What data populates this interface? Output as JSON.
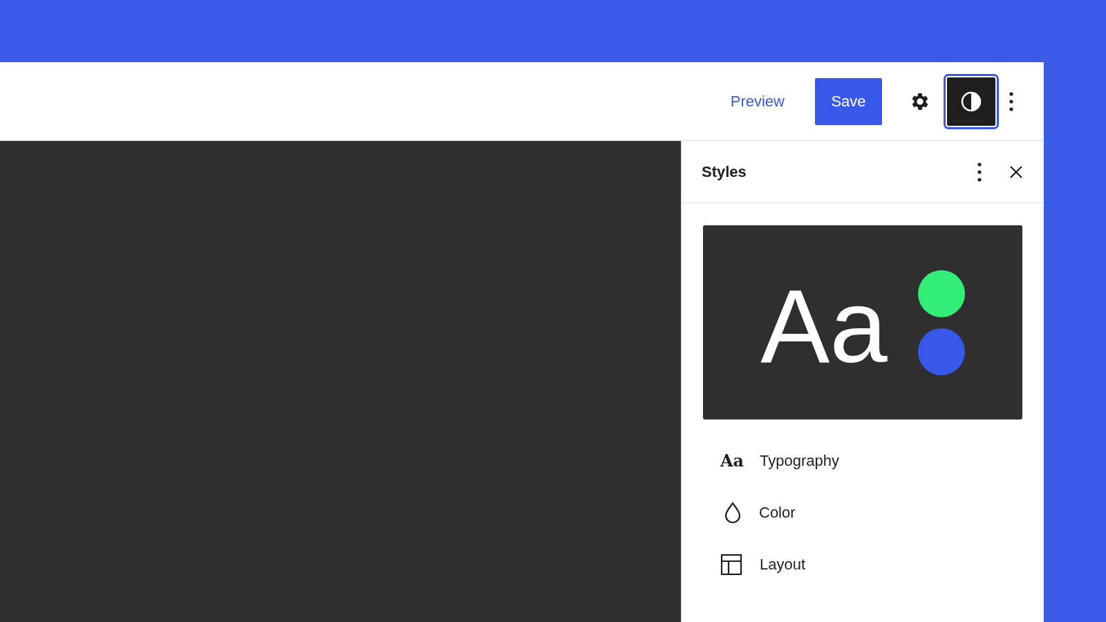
{
  "toolbar": {
    "preview_label": "Preview",
    "save_label": "Save",
    "styles_toggle": {
      "selected": true
    }
  },
  "panel": {
    "title": "Styles",
    "preview": {
      "sample_text": "Aa",
      "swatches": [
        {
          "color": "#33ee77"
        },
        {
          "color": "#3858e9"
        }
      ]
    },
    "items": [
      {
        "kind": "typography",
        "icon_text": "Aa",
        "label": "Typography"
      },
      {
        "kind": "color",
        "label": "Color"
      },
      {
        "kind": "layout",
        "label": "Layout"
      }
    ]
  }
}
